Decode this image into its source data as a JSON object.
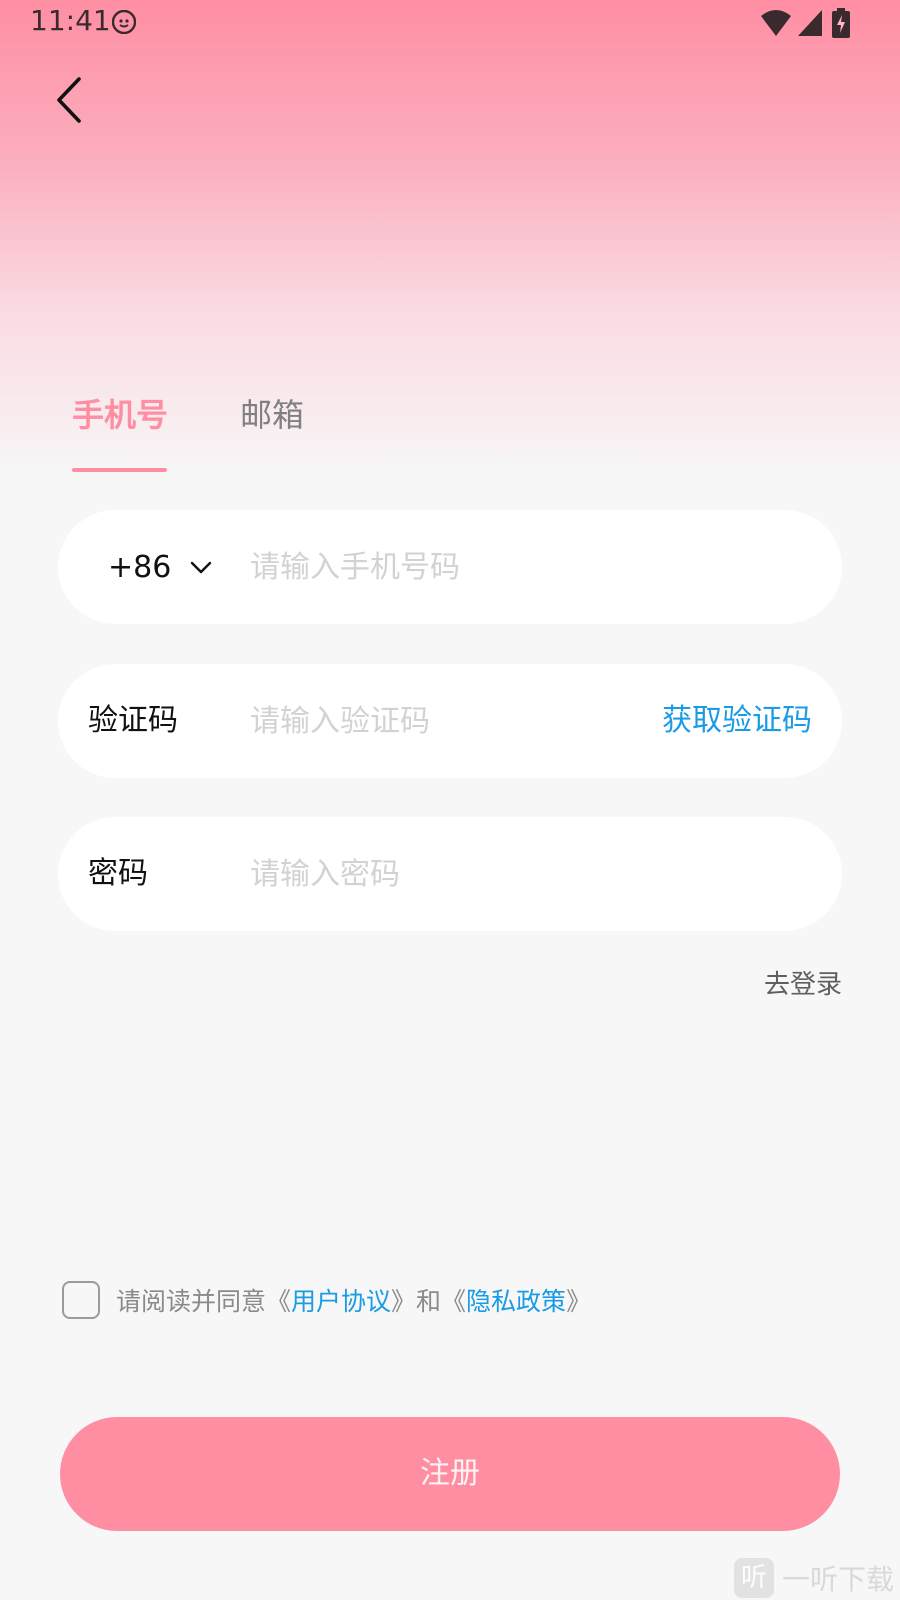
{
  "status_bar": {
    "time": "11:41"
  },
  "tabs": [
    {
      "label": "手机号"
    },
    {
      "label": "邮箱"
    }
  ],
  "phone_field": {
    "country_code": "+86",
    "placeholder": "请输入手机号码"
  },
  "code_field": {
    "label": "验证码",
    "placeholder": "请输入验证码",
    "get_code_label": "获取验证码"
  },
  "password_field": {
    "label": "密码",
    "placeholder": "请输入密码"
  },
  "goto_login_label": "去登录",
  "agreement": {
    "prefix": "请阅读并同意《",
    "user_agreement": "用户协议",
    "middle": "》和《",
    "privacy_policy": "隐私政策",
    "suffix": "》",
    "checked": false
  },
  "register_label": "注册",
  "watermark": {
    "logo_char": "听",
    "text": "一听下载"
  },
  "colors": {
    "accent": "#ff8ea3",
    "link": "#1a9be6"
  }
}
